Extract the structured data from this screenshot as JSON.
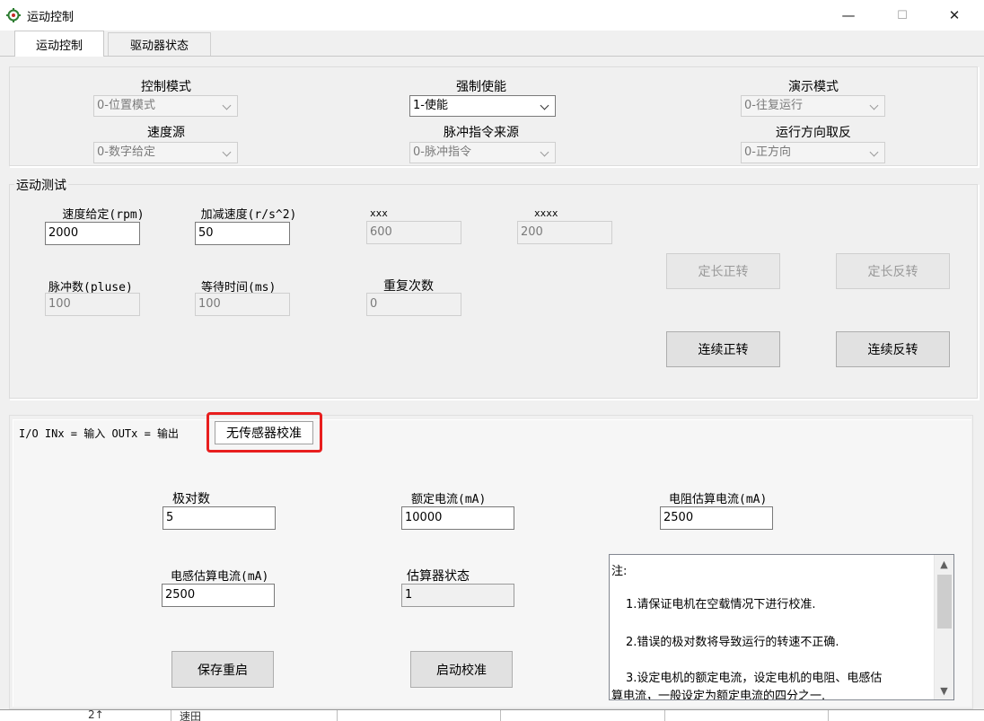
{
  "window": {
    "title": "运动控制",
    "minimize": "—",
    "maximize": "☐",
    "close": "✕"
  },
  "tabs": [
    {
      "label": "运动控制"
    },
    {
      "label": "驱动器状态"
    }
  ],
  "config": {
    "control_mode": {
      "label": "控制模式",
      "value": "0-位置模式"
    },
    "force_enable": {
      "label": "强制使能",
      "value": "1-使能"
    },
    "demo_mode": {
      "label": "演示模式",
      "value": "0-往复运行"
    },
    "speed_source": {
      "label": "速度源",
      "value": "0-数字给定"
    },
    "pulse_source": {
      "label": "脉冲指令来源",
      "value": "0-脉冲指令"
    },
    "direction_invert": {
      "label": "运行方向取反",
      "value": "0-正方向"
    }
  },
  "motion_test": {
    "title": "运动测试",
    "speed": {
      "label": "速度给定(rpm)",
      "value": "2000"
    },
    "accel": {
      "label": "加减速度(r/s^2)",
      "value": "50"
    },
    "xxx": {
      "label": "xxx",
      "value": "600"
    },
    "xxxx": {
      "label": "xxxx",
      "value": "200"
    },
    "pulse_count": {
      "label": "脉冲数(pluse)",
      "value": "100"
    },
    "wait_time": {
      "label": "等待时间(ms)",
      "value": "100"
    },
    "repeat": {
      "label": "重复次数",
      "value": "0"
    },
    "btn_fixed_fwd": "定长正转",
    "btn_fixed_rev": "定长反转",
    "btn_cont_fwd": "连续正转",
    "btn_cont_rev": "连续反转"
  },
  "lower": {
    "io_label": "I/O INx = 输入 OUTx = 输出",
    "sensorless_tab": "无传感器校准",
    "pole_pairs": {
      "label": "极对数",
      "value": "5"
    },
    "rated_current": {
      "label": "额定电流(mA)",
      "value": "10000"
    },
    "resistance_current": {
      "label": "电阻估算电流(mA)",
      "value": "2500"
    },
    "inductance_current": {
      "label": "电感估算电流(mA)",
      "value": "2500"
    },
    "estimator_state": {
      "label": "估算器状态",
      "value": "1"
    },
    "btn_save_restart": "保存重启",
    "btn_start_calib": "启动校准",
    "notes": {
      "line0": "注:",
      "line1": "1.请保证电机在空载情况下进行校准.",
      "line2": "2.错误的极对数将导致运行的转速不正确.",
      "line3": "3.设定电机的额定电流，设定电机的电阻、电感估",
      "line4": "算电流，一般设定为额定电流的四分之一."
    },
    "behind_row": {
      "c1": "2↑",
      "c2": "速田"
    }
  },
  "icons": {
    "app": "gear-icon",
    "scroll_up": "arrow-up-icon",
    "scroll_down": "arrow-down-icon"
  }
}
